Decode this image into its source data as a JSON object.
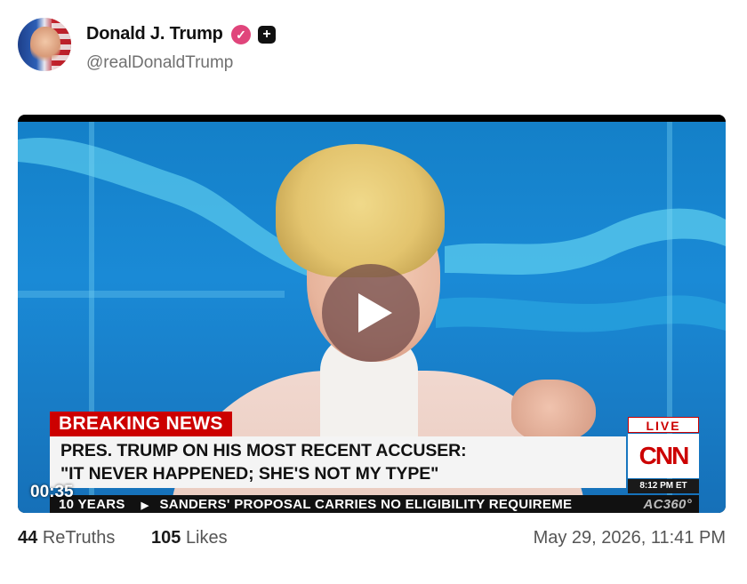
{
  "post": {
    "author_name": "Donald J. Trump",
    "handle": "@realDonaldTrump",
    "verified_icon": "check-badge",
    "plus_icon": "plus-badge",
    "accent_color": "#e0457b"
  },
  "video": {
    "duration": "00:35",
    "breaking_label": "BREAKING NEWS",
    "headline_line1": "PRES. TRUMP ON HIS MOST RECENT ACCUSER:",
    "headline_line2": "\"IT NEVER HAPPENED; SHE'S NOT MY TYPE\"",
    "network_live": "LIVE",
    "network_logo": "CNN",
    "network_time": "8:12 PM ET",
    "ticker_left": "10 YEARS",
    "ticker_main": "SANDERS' PROPOSAL CARRIES NO ELIGIBILITY REQUIREME",
    "ticker_right": "AC360°"
  },
  "stats": {
    "retruths_count": "44",
    "retruths_label": "ReTruths",
    "likes_count": "105",
    "likes_label": "Likes",
    "date": "May 29, 2026, 11:41 PM"
  }
}
